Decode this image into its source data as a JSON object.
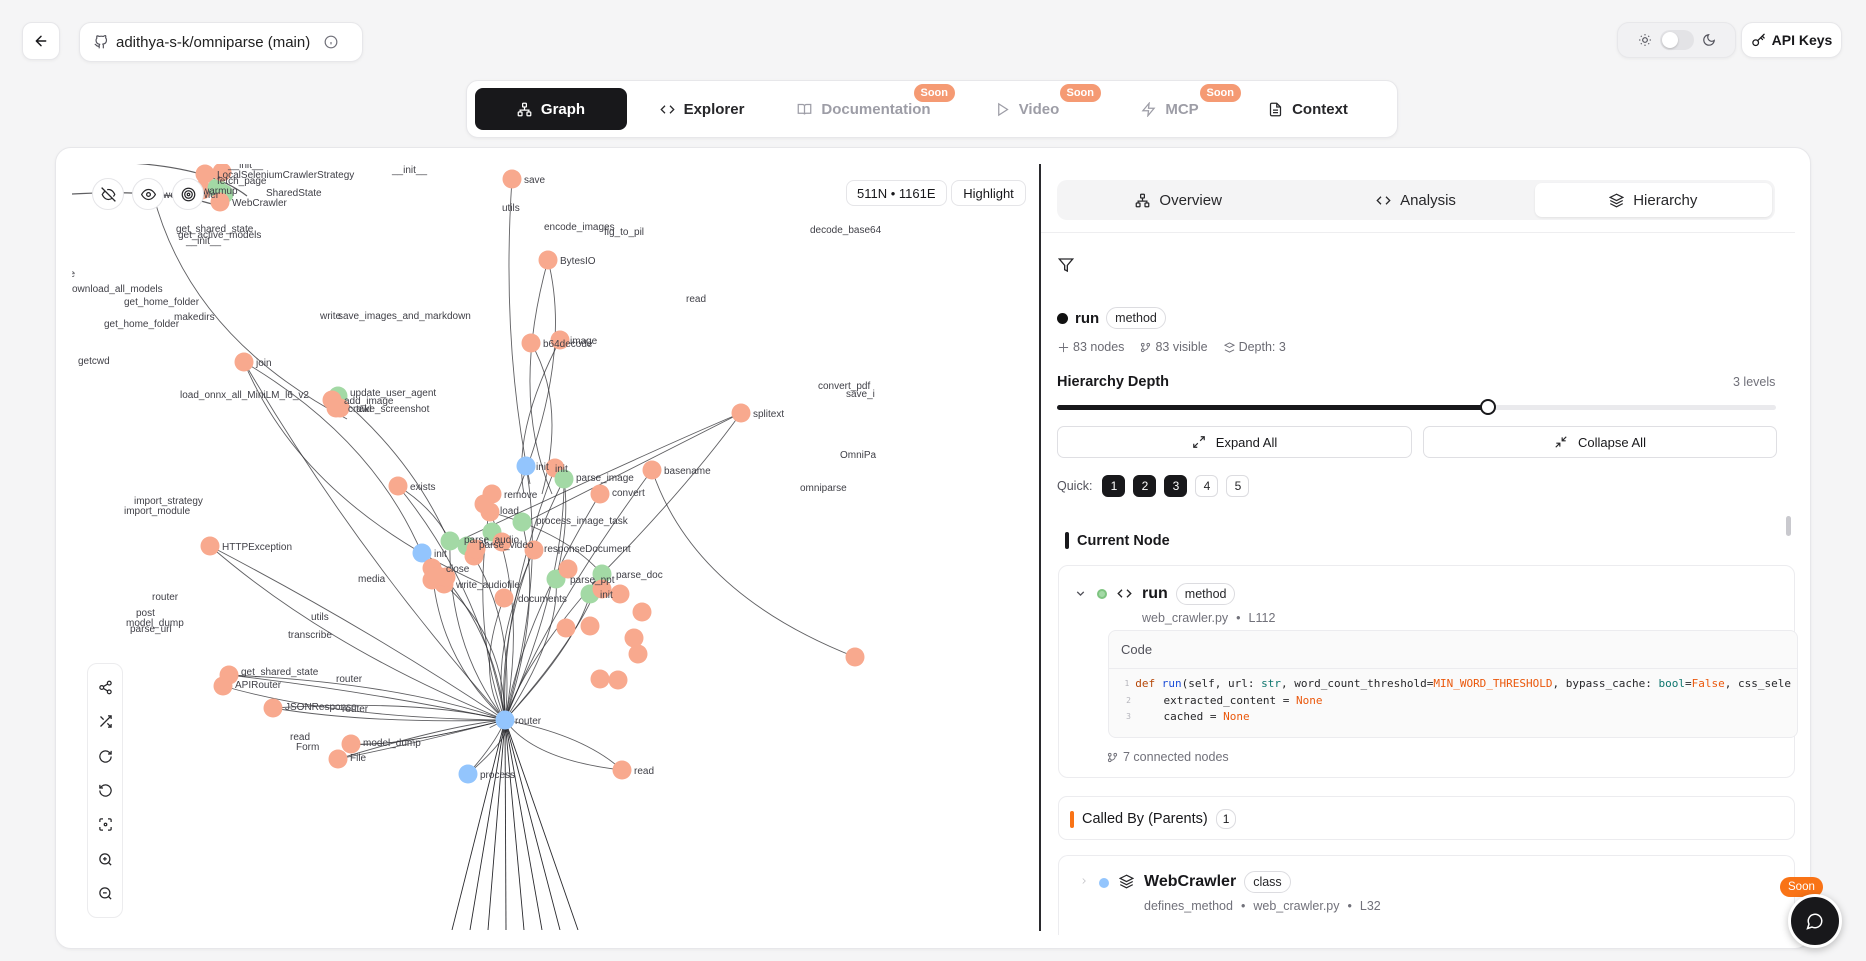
{
  "header": {
    "repo_name": "adithya-s-k/omniparse (main)",
    "api_keys_label": "API Keys"
  },
  "top_tabs": [
    {
      "label": "Graph",
      "active": true,
      "soon": ""
    },
    {
      "label": "Explorer",
      "active": false,
      "soon": ""
    },
    {
      "label": "Documentation",
      "active": false,
      "soon": "Soon"
    },
    {
      "label": "Video",
      "active": false,
      "soon": "Soon"
    },
    {
      "label": "MCP",
      "active": false,
      "soon": "Soon"
    },
    {
      "label": "Context",
      "active": false,
      "soon": ""
    }
  ],
  "graph": {
    "stats": "511N • 1161E",
    "highlight_label": "Highlight",
    "colors": {
      "orange": "#f8a98e",
      "blue": "#93c5fd",
      "green": "#a3d9a5",
      "gray": "#a1a1aa"
    },
    "node_labels": [
      "LocalSeleniumCrawlerStrategy",
      "web_crawler",
      "warmup",
      "fetch_page",
      "__init__",
      "SharedState",
      "WebCrawler",
      "get_shared_state",
      "get_active_models",
      "__init__",
      "ee",
      "ownload_all_models",
      "get_home_folder",
      "get_home_folder",
      "makedirs",
      "getcwd",
      "join",
      "load_onnx_all_MiniLM_l6_v2",
      "chunk_text",
      "responseDocument",
      "__init__",
      "save",
      "utils",
      "encode_images",
      "fig_to_pil",
      "BytesIO",
      "decode_base64",
      "write",
      "save_images_and_markdown",
      "read",
      "b64decode",
      "image",
      "update_user_agent",
      "add_image",
      "crawl",
      "take_screenshot",
      "splitext",
      "convert_pdf",
      "save_i",
      "OmniPa",
      "omniparse",
      "init",
      "parse_image",
      "basename",
      "exists",
      "remove",
      "load",
      "convert",
      "process_image_task",
      "parse_audio",
      "parse_video",
      "responseDocument",
      "init",
      "close",
      "write_audiofile",
      "parse_doc",
      "parse_ppt",
      "documents",
      "init",
      "import_strategy",
      "import_module",
      "HTTPException",
      "media",
      "router",
      "post",
      "model_dump",
      "parse_url",
      "utils",
      "transcribe",
      "get_shared_state",
      "APIRouter",
      "router",
      "JSONResponse",
      "router",
      "read",
      "Form",
      "model_dump",
      "File",
      "router",
      "process",
      "read"
    ]
  },
  "right_panel": {
    "tabs": [
      {
        "label": "Overview",
        "active": false
      },
      {
        "label": "Analysis",
        "active": false
      },
      {
        "label": "Hierarchy",
        "active": true
      }
    ],
    "node": {
      "name": "run",
      "type": "method",
      "nodes_count": "83 nodes",
      "visible_count": "83 visible",
      "depth": "Depth: 3"
    },
    "hierarchy_depth": {
      "label": "Hierarchy Depth",
      "levels": "3 levels",
      "value": 3,
      "max": 5
    },
    "expand_all": "Expand All",
    "collapse_all": "Collapse All",
    "quick_label": "Quick:",
    "quick_levels": [
      "1",
      "2",
      "3",
      "4",
      "5"
    ],
    "current_node": {
      "section_title": "Current Node",
      "name": "run",
      "type": "method",
      "file": "web_crawler.py",
      "line": "L112",
      "code_label": "Code",
      "code_lines": [
        "def run(self, url: str, word_count_threshold=MIN_WORD_THRESHOLD, bypass_cache: bool=False, css_sele",
        "    extracted_content = None",
        "    cached = None"
      ],
      "connected": "7 connected nodes"
    },
    "called_by": {
      "section_title": "Called By (Parents)",
      "count": "1",
      "item": {
        "name": "WebCrawler",
        "type": "class",
        "relation": "defines_method",
        "file": "web_crawler.py",
        "line": "L32"
      }
    }
  },
  "chat": {
    "soon": "Soon"
  }
}
